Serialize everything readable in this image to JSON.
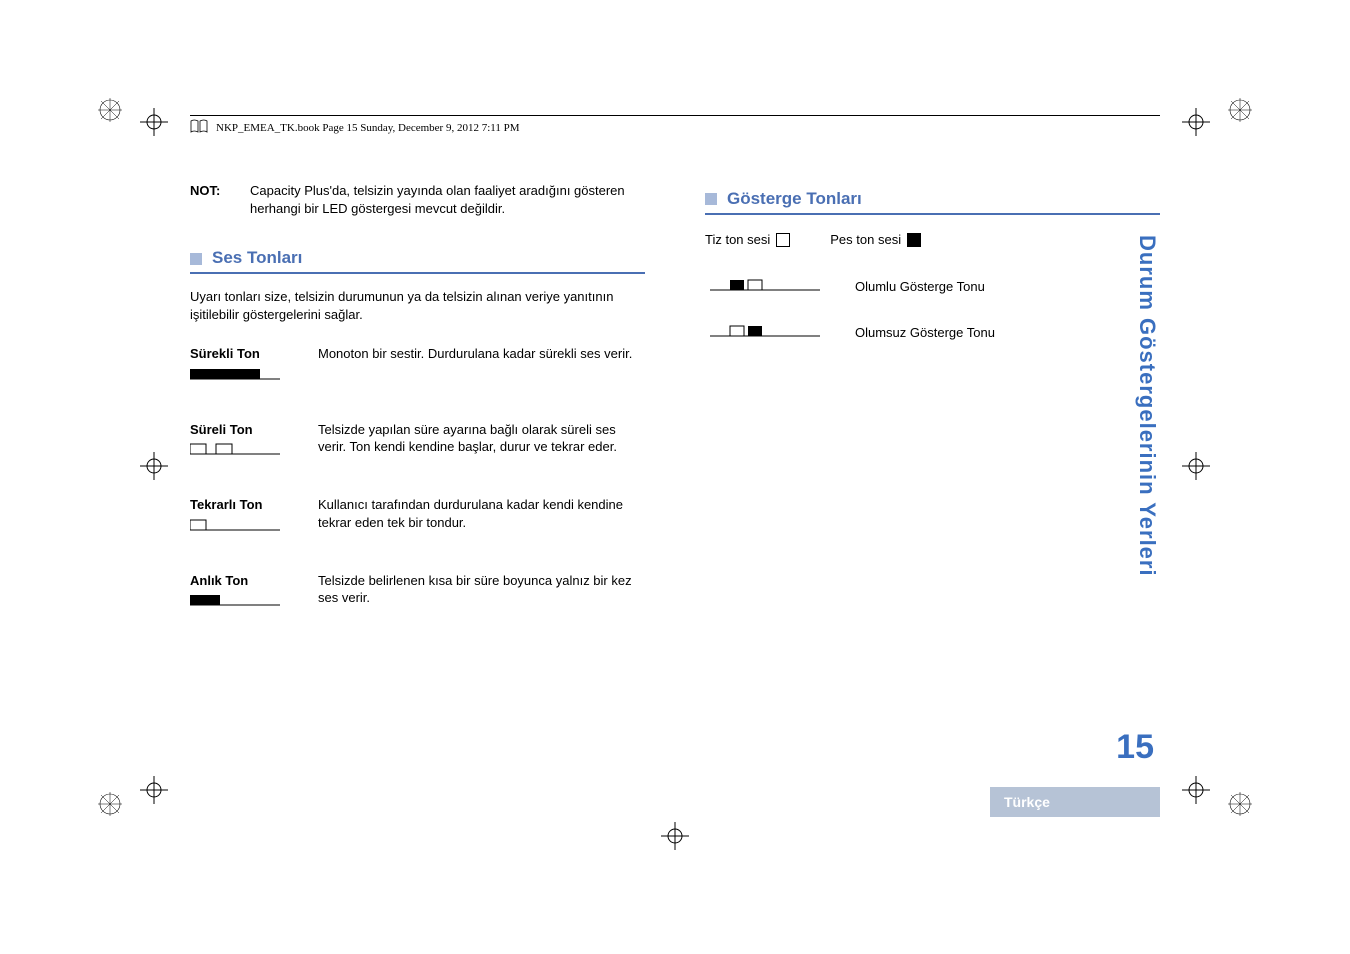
{
  "running_head": "NKP_EMEA_TK.book  Page 15  Sunday, December 9, 2012  7:11 PM",
  "note": {
    "label": "NOT:",
    "text": "Capacity Plus'da, telsizin yayında olan faaliyet aradığını gösteren herhangi bir LED göstergesi mevcut değildir."
  },
  "sections": {
    "audio": {
      "title": "Ses Tonları",
      "intro": "Uyarı tonları size, telsizin durumunun ya da telsizin alınan veriye yanıtının işitilebilir göstergelerini sağlar.",
      "tones": [
        {
          "name": "Sürekli Ton",
          "desc": "Monoton bir sestir. Durdurulana kadar sürekli ses verir.",
          "pattern": "continuous"
        },
        {
          "name": "Süreli Ton",
          "desc": "Telsizde yapılan süre ayarına bağlı olarak süreli ses verir. Ton kendi kendine başlar, durur ve tekrar eder.",
          "pattern": "periodic"
        },
        {
          "name": "Tekrarlı Ton",
          "desc": "Kullanıcı tarafından durdurulana kadar kendi kendine tekrar eden tek bir tondur.",
          "pattern": "repetitive"
        },
        {
          "name": "Anlık Ton",
          "desc": "Telsizde belirlenen kısa bir süre boyunca yalnız bir kez ses verir.",
          "pattern": "momentary"
        }
      ]
    },
    "indicator": {
      "title": "Gösterge Tonları",
      "legend": {
        "high": "Tiz ton sesi",
        "low": "Pes ton sesi"
      },
      "items": [
        {
          "label": "Olumlu Gösterge Tonu",
          "pattern": "positive"
        },
        {
          "label": "Olumsuz Gösterge Tonu",
          "pattern": "negative"
        }
      ]
    }
  },
  "side": {
    "tab": "Durum Göstergelerinin Yerleri",
    "page": "15",
    "lang": "Türkçe"
  }
}
